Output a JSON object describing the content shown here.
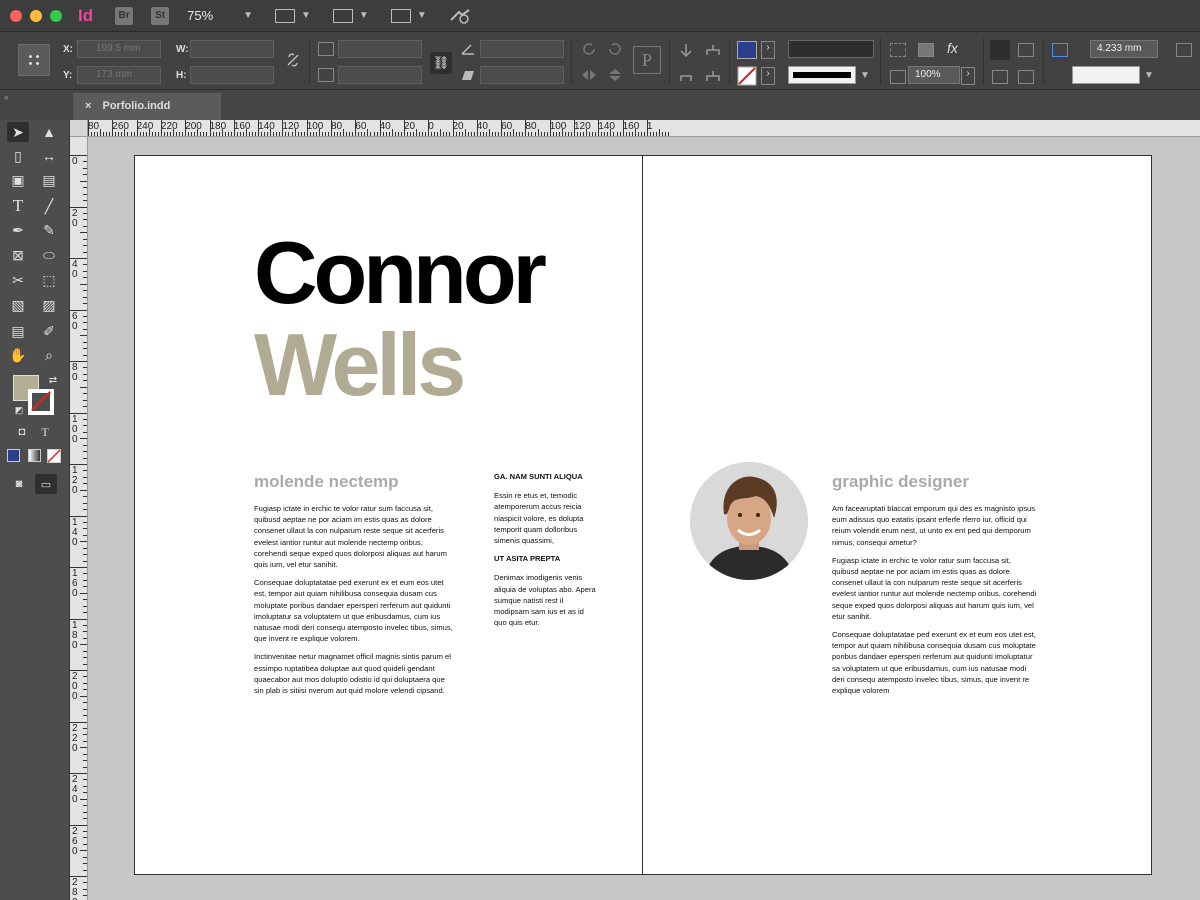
{
  "app": {
    "logo": "Id",
    "bridge_label": "Br",
    "stock_label": "St",
    "zoom": "75%"
  },
  "control_panel": {
    "x_label": "X:",
    "y_label": "Y:",
    "w_label": "W:",
    "h_label": "H:",
    "x_value": "199.5 mm",
    "y_value": "173 mm",
    "opacity": "100%",
    "dimension": "4.233 mm",
    "fill_color": "#2b3f8c",
    "stroke_color": "none"
  },
  "tab": {
    "close": "×",
    "filename": "Porfolio.indd"
  },
  "ruler": {
    "top_labels": [
      "80",
      "260",
      "240",
      "220",
      "200",
      "180",
      "160",
      "140",
      "120",
      "100",
      "80",
      "60",
      "40",
      "20",
      "0",
      "20",
      "40",
      "60",
      "80",
      "100",
      "120",
      "140",
      "160",
      "1"
    ],
    "left_labels": [
      "0",
      "2 0",
      "4 0",
      "6 0",
      "8 0",
      "1 0 0",
      "1 2 0",
      "1 4 0",
      "1 6 0",
      "1 8 0",
      "2 0 0",
      "2 2 0",
      "2 4 0",
      "2 6 0",
      "2 8 0"
    ]
  },
  "tools": {
    "fill_color": "#b5ae97"
  },
  "document": {
    "first_name": "Connor",
    "last_name": "Wells",
    "accent_color": "#b2ab93",
    "left": {
      "subhead": "molende nectemp",
      "paragraphs": [
        "Fugiasp ictate in erchic te volor ratur sum faccusa sit, quibusd aeptae ne por aciam im estis quas as dolore consenet ullaut la con nulparum reste seque sit acerferis evelest iantior runtur aut molende nectemp oribus, corehendi seque exped quos dolorposi aliquas aut harum quis ium, vel etur sanihit.",
        "Consequae doluptatatae ped exerunt ex et eum eos utet est, tempor aut quiam nihilibusa consequia dusam cus moluptate poribus dandaer epersperi rerferum aut quidunti imoluptatur sa voluptatem ut que eribusdamus, cum ius natusae modi deri consequ atemposto invelec tibus, simus, que invent re explique volorem.",
        "Inctinvenitae netur magnamet officil magnis sintis parum el essimpo ruptatibea doluptae aut quod quideli gendant quaecabor aut mos doluptio odistio id qui doluptaera que sin plab is sitiisi nverum aut quid molore velendi cipsand."
      ],
      "side_head_1": "GA. NAM SUNTI ALIQUA",
      "side_text_1": "Essin re etus et, temodic atemporerum accus reicia niaspicit volore, es dolupta temporit quam dolloribus simenis quassimi,",
      "side_head_2": "UT ASITA PREPTA",
      "side_text_2": "Denimax imodigenis venis aliquia de voluptas abo. Apera sumque natisti rest il modipsam sam ius et as id quo quis etur."
    },
    "right": {
      "subhead": "graphic designer",
      "paragraphs": [
        "Am facearuptati blaccat emporum qui des es magnisto ipsus eum adissus quo eatatis ipsant erferfe rferro iur, officid qui reium volendit erum nest, ut unto ex ent ped qui demporum nimus, consequi ametur?",
        "Fugiasp ictate in erchic te volor ratur sum faccusa sit, quibusd aeptae ne por aciam im estis quas as dolore consenet ullaut la con nulparum reste seque sit acerferis evelest iantior runtur aut molende nectemp oribus, corehendi seque exped quos dolorposi aliquas aut harum quis ium, vel etur sanihit.",
        "Consequae doluptatatae ped exerunt ex et eum eos utet est, tempor aut quiam nihilibusa consequia dusam cus moluptate poribus dandaer epersperi rerferum aut quidunti imoluptatur sa voluptatem ut que eribusdamus, cum ius natusae modi deri consequ atemposto invelec tibus, simus, que invent re explique volorem"
      ]
    }
  }
}
